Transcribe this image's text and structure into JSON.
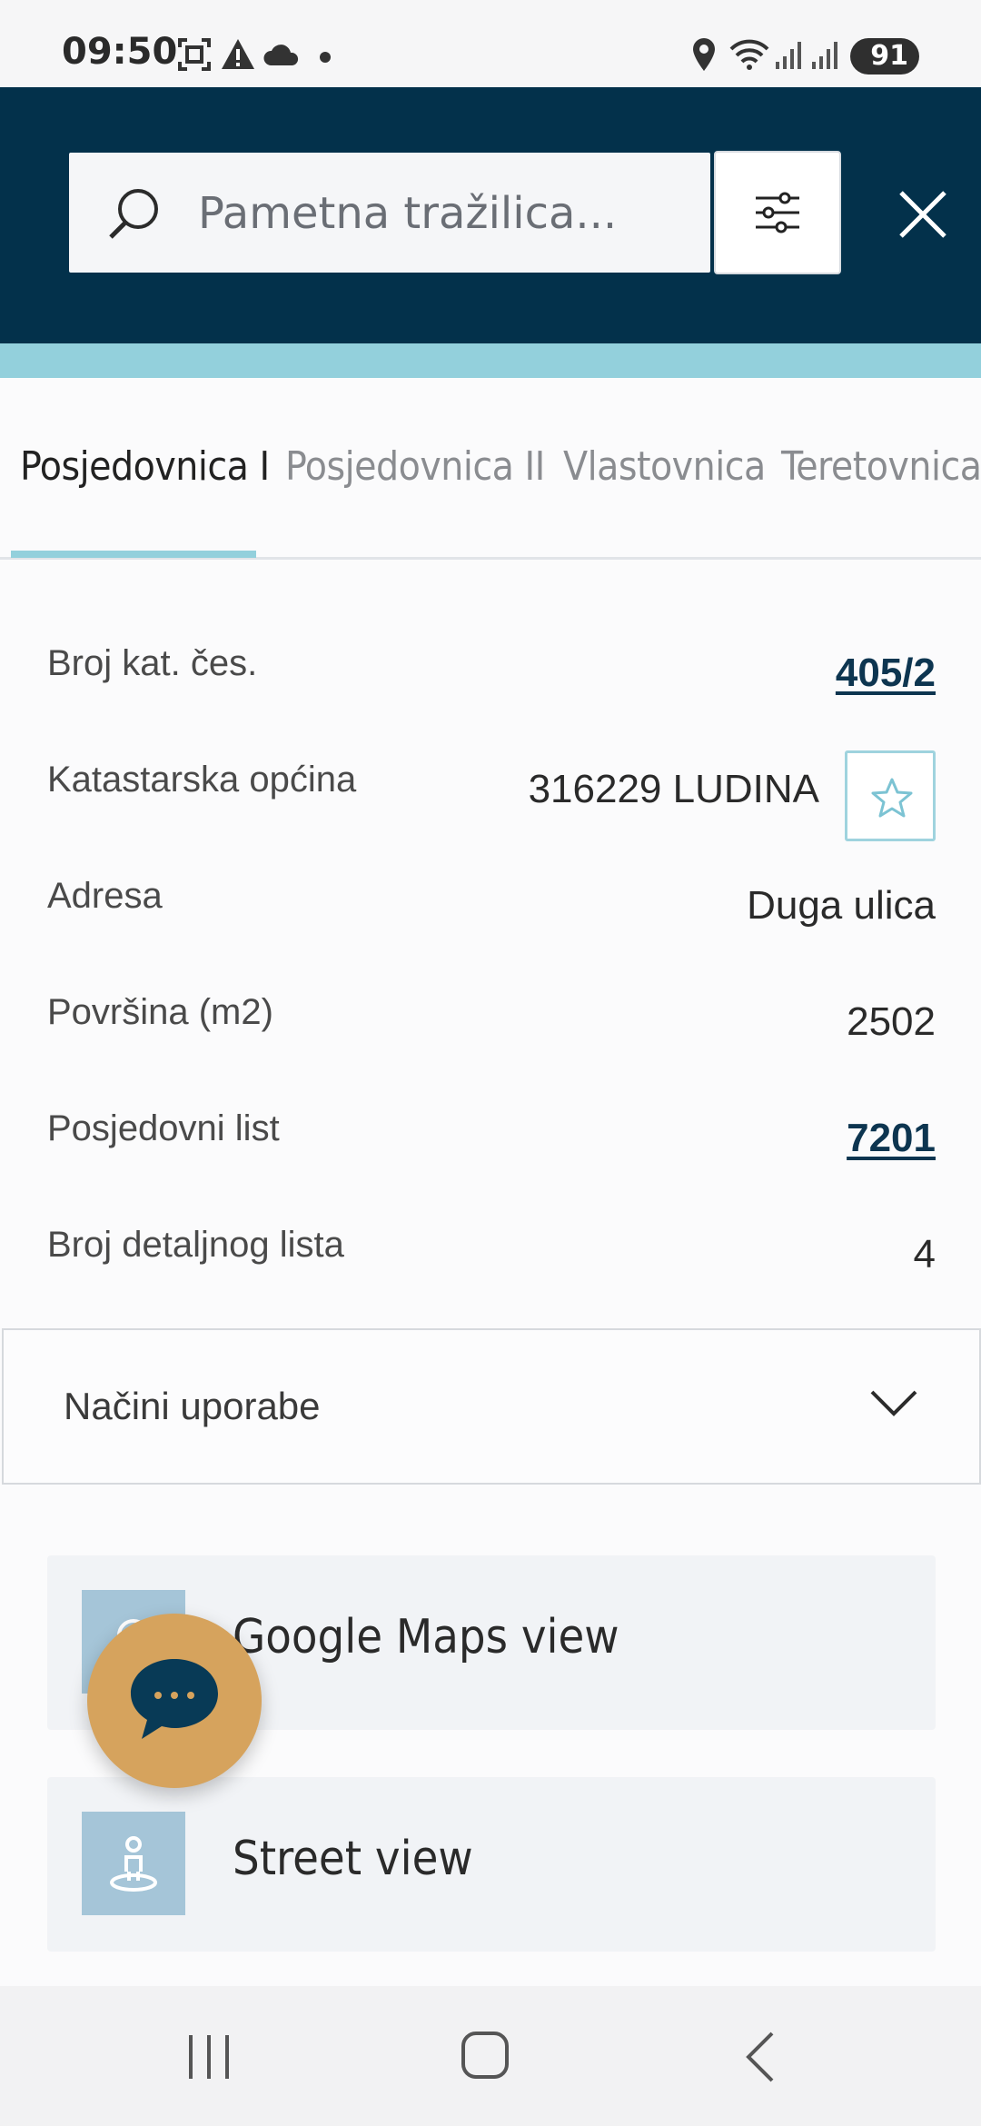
{
  "status_bar": {
    "time": "09:50",
    "battery": "91"
  },
  "header": {
    "search_placeholder": "Pametna tražilica..."
  },
  "tabs": [
    {
      "label": "Posjedovnica I",
      "active": true
    },
    {
      "label": "Posjedovnica II",
      "active": false
    },
    {
      "label": "Vlastovnica",
      "active": false
    },
    {
      "label": "Teretovnica",
      "active": false
    }
  ],
  "details": [
    {
      "label": "Broj kat. čes.",
      "value": "405/2",
      "link": true
    },
    {
      "label": "Katastarska općina",
      "value": "316229 LUDINA",
      "link": false
    },
    {
      "label": "Adresa",
      "value": "Duga ulica",
      "link": false
    },
    {
      "label": "Površina (m2)",
      "value": "2502",
      "link": false
    },
    {
      "label": "Posjedovni list",
      "value": "7201",
      "link": true
    },
    {
      "label": "Broj detaljnog lista",
      "value": "4",
      "link": false
    }
  ],
  "accordion": {
    "label": "Načini uporabe"
  },
  "cards": [
    {
      "label": "Google Maps view",
      "icon": "map-pin-icon"
    },
    {
      "label": "Street view",
      "icon": "street-view-icon"
    }
  ],
  "colors": {
    "header_bg": "#03314b",
    "accent": "#93d0dc",
    "fab": "#d6a35d",
    "link": "#0d3550"
  }
}
